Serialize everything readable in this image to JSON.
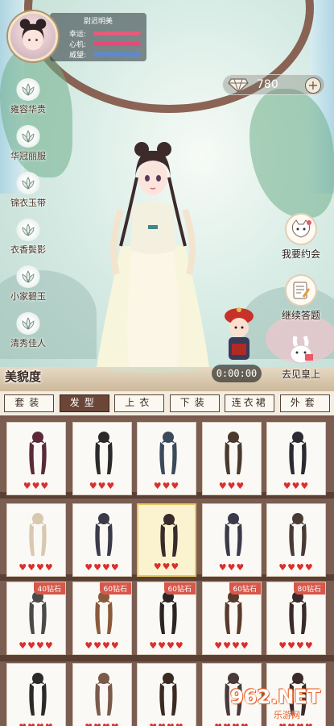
{
  "profile": {
    "name": "尉迟明美",
    "stats": [
      {
        "label": "幸运:",
        "color": "#e65a7a",
        "level": 0.95
      },
      {
        "label": "心机:",
        "color": "#e64a7a",
        "level": 0.95
      },
      {
        "label": "威望:",
        "color": "#5a8ad6",
        "level": 0.95
      }
    ]
  },
  "currency": {
    "diamonds": "780",
    "add_label": "+"
  },
  "left_menu": [
    "雍容华贵",
    "华冠丽服",
    "锦衣玉带",
    "衣香鬓影",
    "小家碧玉",
    "清秀佳人"
  ],
  "beauty_label": "美貌度",
  "right_menu": [
    {
      "label": "我要约会",
      "icon": "cat-icon"
    },
    {
      "label": "继续答题",
      "icon": "quiz-icon"
    },
    {
      "label": "去见皇上",
      "icon": "rabbit-icon"
    }
  ],
  "timer": "0:00:00",
  "tabs": [
    {
      "label": "套装",
      "active": false
    },
    {
      "label": "发型",
      "active": true
    },
    {
      "label": "上衣",
      "active": false
    },
    {
      "label": "下装",
      "active": false
    },
    {
      "label": "连衣裙",
      "active": false
    },
    {
      "label": "外套",
      "active": false
    }
  ],
  "items": [
    {
      "hearts": 3,
      "price": ""
    },
    {
      "hearts": 3,
      "price": ""
    },
    {
      "hearts": 3,
      "price": ""
    },
    {
      "hearts": 3,
      "price": ""
    },
    {
      "hearts": 3,
      "price": ""
    },
    {
      "hearts": 4,
      "price": ""
    },
    {
      "hearts": 4,
      "price": ""
    },
    {
      "hearts": 3,
      "price": "",
      "selected": true
    },
    {
      "hearts": 3,
      "price": ""
    },
    {
      "hearts": 4,
      "price": ""
    },
    {
      "hearts": 4,
      "price": "40钻石"
    },
    {
      "hearts": 4,
      "price": "60钻石"
    },
    {
      "hearts": 4,
      "price": "60钻石"
    },
    {
      "hearts": 4,
      "price": "60钻石"
    },
    {
      "hearts": 4,
      "price": "80钻石"
    },
    {
      "hearts": 4,
      "price": ""
    },
    {
      "hearts": 4,
      "price": ""
    },
    {
      "hearts": 4,
      "price": ""
    },
    {
      "hearts": 4,
      "price": ""
    },
    {
      "hearts": 4,
      "price": ""
    }
  ],
  "watermark": {
    "big": "962.NET",
    "small": "乐游网"
  }
}
